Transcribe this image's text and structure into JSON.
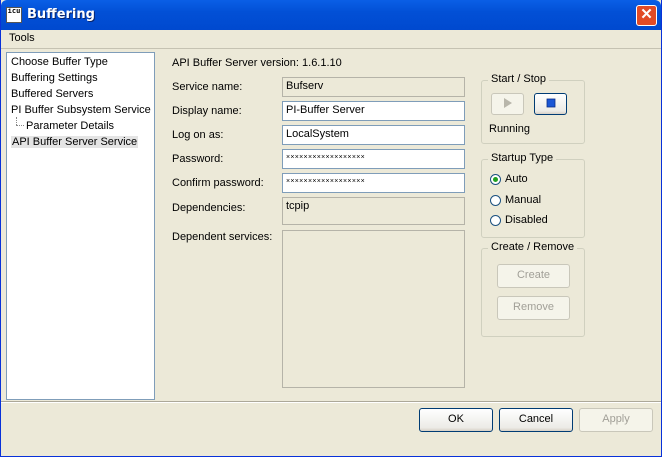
{
  "window": {
    "title": "Buffering",
    "icon_text": "icu"
  },
  "menu": {
    "tools": "Tools"
  },
  "tree": {
    "items": [
      "Choose Buffer Type",
      "Buffering Settings",
      "Buffered Servers",
      "PI Buffer Subsystem Service",
      "Parameter Details",
      "API Buffer Server Service"
    ],
    "selected": "API Buffer Server Service"
  },
  "service": {
    "version_text": "API Buffer Server version: 1.6.1.10",
    "service_name_label": "Service name:",
    "service_name_value": "Bufserv",
    "display_name_label": "Display name:",
    "display_name_value": "PI-Buffer Server",
    "logon_label": "Log on as:",
    "logon_value": "LocalSystem",
    "password_label": "Password:",
    "password_value": "××××××××××××××××××",
    "confirm_label": "Confirm password:",
    "confirm_value": "××××××××××××××××××",
    "dependencies_label": "Dependencies:",
    "dependencies_value": "tcpip",
    "dependents_label": "Dependent services:",
    "dependents_value": ""
  },
  "start_stop": {
    "title": "Start / Stop",
    "status": "Running",
    "start_icon": "play-icon",
    "stop_icon": "stop-icon"
  },
  "startup": {
    "title": "Startup Type",
    "options": [
      "Auto",
      "Manual",
      "Disabled"
    ],
    "selected": "Auto"
  },
  "create_remove": {
    "title": "Create / Remove",
    "create": "Create",
    "remove": "Remove"
  },
  "footer": {
    "ok": "OK",
    "cancel": "Cancel",
    "apply": "Apply"
  },
  "colors": {
    "titlebar": "#0054e3",
    "close": "#e24b26",
    "face": "#ece9d8",
    "radio_dot": "#21a121",
    "stop": "#1a56d6"
  }
}
